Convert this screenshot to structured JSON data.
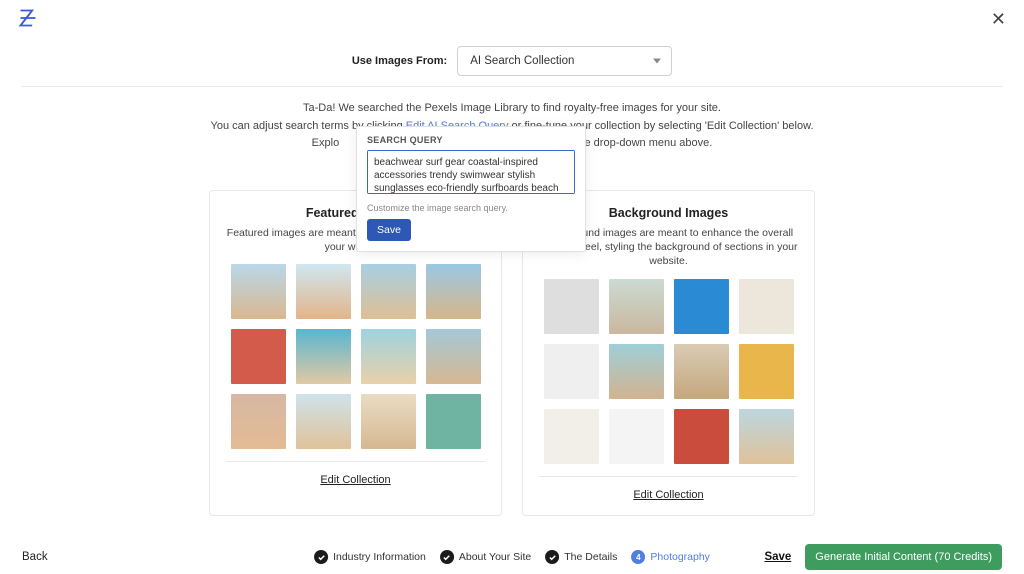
{
  "header": {
    "source_label": "Use Images From:",
    "source_value": "AI Search Collection"
  },
  "intro": {
    "line1": "Ta-Da! We searched the Pexels Image Library to find royalty-free images for your site.",
    "line2a": "You can adjust search terms by clicking ",
    "edit_link": "Edit AI Search Query",
    "line2b": " or fine-tune your collection by selecting 'Edit Collection' below.",
    "line3a": "Explo",
    "line3b": "the drop-down menu above."
  },
  "popover": {
    "title": "SEARCH QUERY",
    "value": "beachwear surf gear coastal-inspired accessories trendy swimwear stylish sunglasses eco-friendly surfboards beach essentials",
    "hint": "Customize the image search query.",
    "save": "Save"
  },
  "featured": {
    "title": "Featured Images",
    "sub": "Featured images are meant to represent the content on your website.",
    "edit": "Edit Collection"
  },
  "background": {
    "title": "Background Images",
    "sub": "Background images are meant to enhance the overall look and feel, styling the background of sections in your website.",
    "edit": "Edit Collection"
  },
  "footer": {
    "back": "Back",
    "steps": {
      "s1": "Industry Information",
      "s2": "About Your Site",
      "s3": "The Details",
      "s4_num": "4",
      "s4": "Photography"
    },
    "save": "Save",
    "generate": "Generate Initial Content (70 Credits)"
  }
}
